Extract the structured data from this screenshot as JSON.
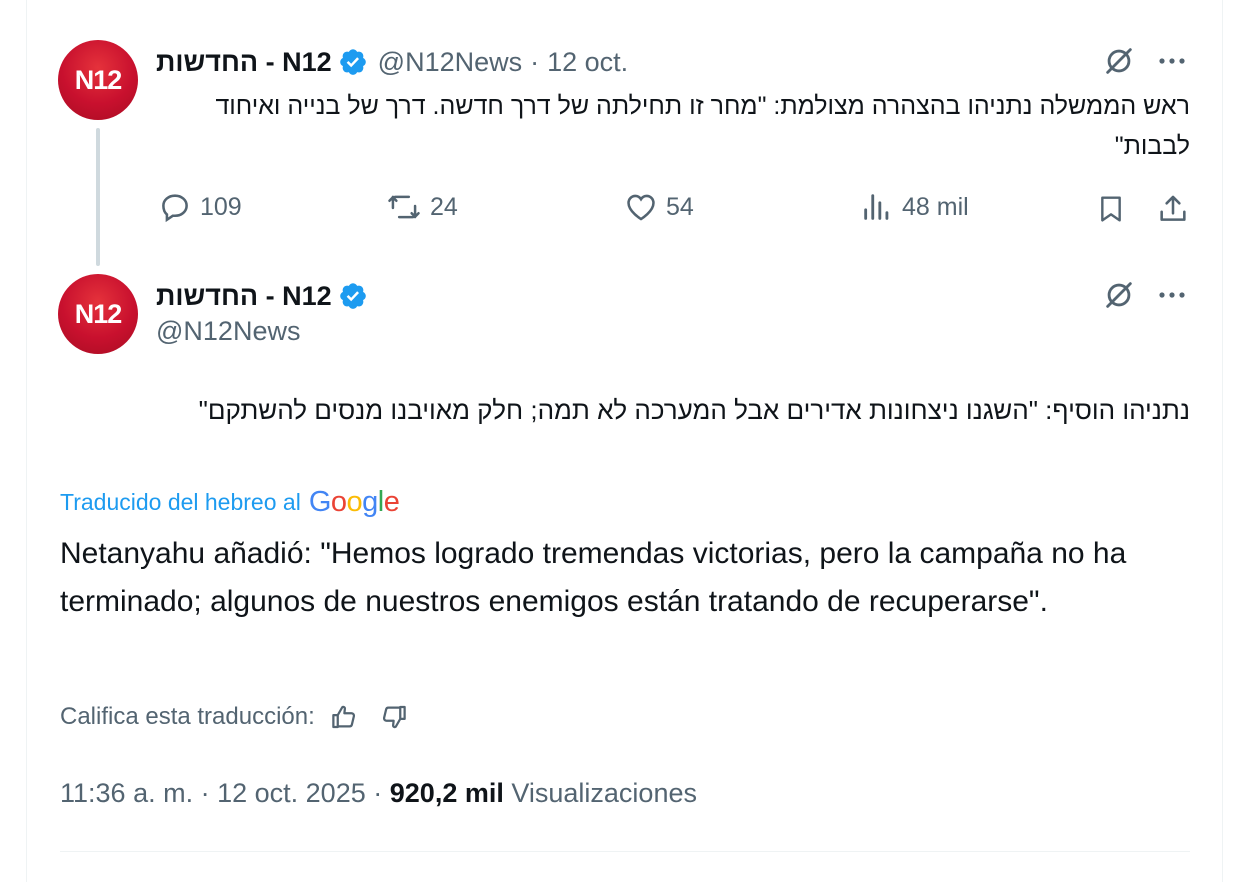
{
  "colors": {
    "brand_red": "#c8102e",
    "verified_blue": "#1d9bf0",
    "secondary_text": "#536471",
    "primary_text": "#0f1419"
  },
  "parent_tweet": {
    "avatar_text": "N12",
    "display_name": "N12 - החדשות",
    "handle": "@N12News",
    "separator": "·",
    "date": "12 oct.",
    "text": "ראש הממשלה נתניהו בהצהרה מצולמת: \"מחר זו תחילתה של דרך חדשה. דרך של בנייה ואיחוד לבבות\"",
    "stats": {
      "replies": "109",
      "reposts": "24",
      "likes": "54",
      "views": "48 mil"
    },
    "icons": [
      "grok-icon",
      "more-icon",
      "reply-icon",
      "repost-icon",
      "like-icon",
      "views-icon",
      "bookmark-icon",
      "share-icon"
    ]
  },
  "main_tweet": {
    "avatar_text": "N12",
    "display_name": "N12 - החדשות",
    "handle": "@N12News",
    "text": "נתניהו הוסיף: \"השגנו ניצחונות אדירים אבל המערכה לא תמה; חלק מאויבנו מנסים להשתקם\"",
    "translation_label": "Traducido del hebreo al",
    "translation_provider": "Google",
    "translation": "Netanyahu añadió: \"Hemos logrado tremendas victorias, pero la campaña no ha terminado; algunos de nuestros enemigos están tratando de recuperarse\".",
    "rate_label": "Califica esta traducción:",
    "time": "11:36 a. m.",
    "separator": "·",
    "date": "12 oct. 2025",
    "views_count": "920,2 mil",
    "views_label": "Visualizaciones"
  }
}
